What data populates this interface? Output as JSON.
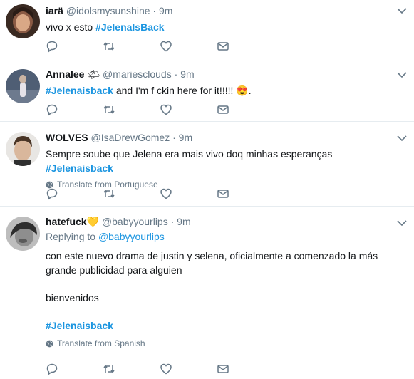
{
  "colors": {
    "accent": "#1b95e0",
    "muted": "#657786",
    "divider": "#e6ecf0"
  },
  "tweets": [
    {
      "name": "iarä",
      "handle": "@idolsmysunshine",
      "time": "· 9m",
      "text_prefix": "vivo x esto ",
      "hashtag": "#JelenaIsBack"
    },
    {
      "name": "Annalee",
      "name_emoji": "🌤",
      "handle": "@mariesclouds",
      "time": "· 9m",
      "hashtag": "#Jelenaisback",
      "text_suffix": " and I'm f   ckin here for it!!!!! 😍."
    },
    {
      "name": "WOLVES",
      "handle": "@IsaDrewGomez",
      "time": "· 9m",
      "text_prefix": "Sempre soube que Jelena era mais vivo doq minhas esperanças ",
      "hashtag": "#Jelenaisback",
      "translate": "Translate from Portuguese"
    },
    {
      "name": "hatefuck",
      "name_emoji": "💛",
      "handle": "@babyyourlips",
      "time": "· 9m",
      "replying_prefix": "Replying to ",
      "replying_to": "@babyyourlips",
      "paragraph1": "con este nuevo drama de justin y selena, oficialmente a comenzado la más grande publicidad para alguien",
      "paragraph2": "bienvenidos",
      "hashtag": "#Jelenaisback",
      "translate": "Translate from Spanish"
    }
  ],
  "icons": [
    "reply-icon",
    "retweet-icon",
    "like-icon",
    "direct-message-icon",
    "caret-down-icon",
    "globe-icon"
  ]
}
